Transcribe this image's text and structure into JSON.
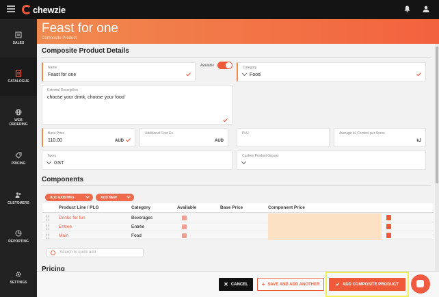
{
  "app": {
    "logo_text": "chewzie"
  },
  "sidebar": {
    "items": [
      {
        "label": "SALES",
        "icon": "sales-icon"
      },
      {
        "label": "CATALOGUE",
        "icon": "catalogue-icon"
      },
      {
        "label": "WEB ORDERING",
        "icon": "web-ordering-icon"
      },
      {
        "label": "PRICING",
        "icon": "tag-icon"
      },
      {
        "label": "CUSTOMERS",
        "icon": "customers-icon"
      },
      {
        "label": "REPORTING",
        "icon": "reporting-icon"
      },
      {
        "label": "SETTINGS",
        "icon": "gear-icon"
      }
    ]
  },
  "header": {
    "title": "Feast for one",
    "subtitle": "Composite Product"
  },
  "details": {
    "section_title": "Composite Product Details",
    "name_label": "Name",
    "name_value": "Feast for one",
    "available_label": "Available",
    "available": true,
    "category_label": "Category",
    "category_value": "Food",
    "ext_desc_label": "External Description",
    "ext_desc_value": "choose your drink, choose your food",
    "base_price_label": "Base Price",
    "base_price_value": "110.00",
    "base_price_unit": "AUD",
    "add_cost_label": "Additional Cost Ex",
    "add_cost_unit": "AUD",
    "plu_label": "PLU",
    "kj_label": "Average kJ Content per Serve",
    "kj_unit": "kJ",
    "taxes_label": "Taxes",
    "taxes_value": "GST",
    "cpg_label": "Custom Product Groups"
  },
  "components": {
    "section_title": "Components",
    "add_existing": "ADD EXISTING",
    "add_new": "ADD NEW",
    "headers": {
      "product": "Product Line / PLG",
      "category": "Category",
      "available": "Available",
      "base_price": "Base Price",
      "component_price": "Component Price"
    },
    "rows": [
      {
        "product": "Drinks for fun",
        "category": "Beverages"
      },
      {
        "product": "Entree",
        "category": "Entrée"
      },
      {
        "product": "Main",
        "category": "Food"
      }
    ],
    "search_placeholder": "Search to quick add"
  },
  "pricing": {
    "section_title": "Pricing"
  },
  "footer": {
    "cancel": "CANCEL",
    "save_add_another": "SAVE AND ADD ANOTHER",
    "add_composite": "ADD COMPOSITE PRODUCT"
  },
  "colors": {
    "accent": "#ee5a3a",
    "hero_start": "#f08b50",
    "hero_end": "#f3613e",
    "highlight": "#f0ef5a"
  }
}
